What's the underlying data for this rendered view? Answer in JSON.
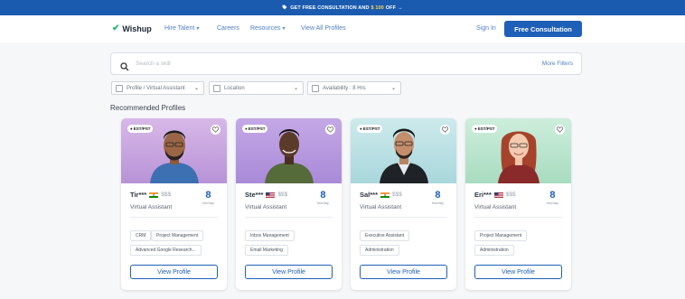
{
  "promo": {
    "icon": "tag-icon",
    "text_before": "GET FREE CONSULTATION AND",
    "amount": "$ 100",
    "text_after": "OFF",
    "arrow": "→"
  },
  "nav": {
    "logo_text": "Wishup",
    "hire_talent": "Hire Talent",
    "careers": "Careers",
    "resources": "Resources",
    "view_all": "View All Profiles",
    "sign_in": "Sign In",
    "cta": "Free Consultation"
  },
  "search": {
    "placeholder": "Search a skill",
    "more_filters": "More Filters"
  },
  "filters": [
    {
      "label": "Profile / Virtual Assistant"
    },
    {
      "label": "Location"
    },
    {
      "label": "Availability : 8 Hrs"
    }
  ],
  "section_title": "Recommended Profiles",
  "profiles": [
    {
      "badge": "EST/PST",
      "name": "Tir***",
      "flag": "India",
      "price": "$$$",
      "role": "Virtual Assistant",
      "hours": "8",
      "hours_unit": "hrs/day",
      "tags": [
        "CRM",
        "Project Management",
        "Advanced Google Research..."
      ],
      "button": "View Profile",
      "bg_color": "#c7a9df"
    },
    {
      "badge": "EST/PST",
      "name": "Ste***",
      "flag": "USA",
      "price": "$$$",
      "role": "Virtual Assistant",
      "hours": "8",
      "hours_unit": "hrs/day",
      "tags": [
        "Inbox Management",
        "Email Marketing"
      ],
      "button": "View Profile",
      "bg_color": "#b9a0de"
    },
    {
      "badge": "EST/PST",
      "name": "Sal***",
      "flag": "India",
      "price": "$$$",
      "role": "Virtual Assistant",
      "hours": "8",
      "hours_unit": "hrs/day",
      "tags": [
        "Executive Assistant",
        "Administration"
      ],
      "button": "View Profile",
      "bg_color": "#bfe3e6"
    },
    {
      "badge": "EST/PST",
      "name": "Eri***",
      "flag": "USA",
      "price": "$$$",
      "role": "Virtual Assistant",
      "hours": "8",
      "hours_unit": "hrs/day",
      "tags": [
        "Project Management",
        "Administration"
      ],
      "button": "View Profile",
      "bg_color": "#bfe6d2"
    }
  ],
  "colors": {
    "primary": "#1e5fb8",
    "promo_bg": "#1a5bb0",
    "accent_yellow": "#ffd84d"
  }
}
